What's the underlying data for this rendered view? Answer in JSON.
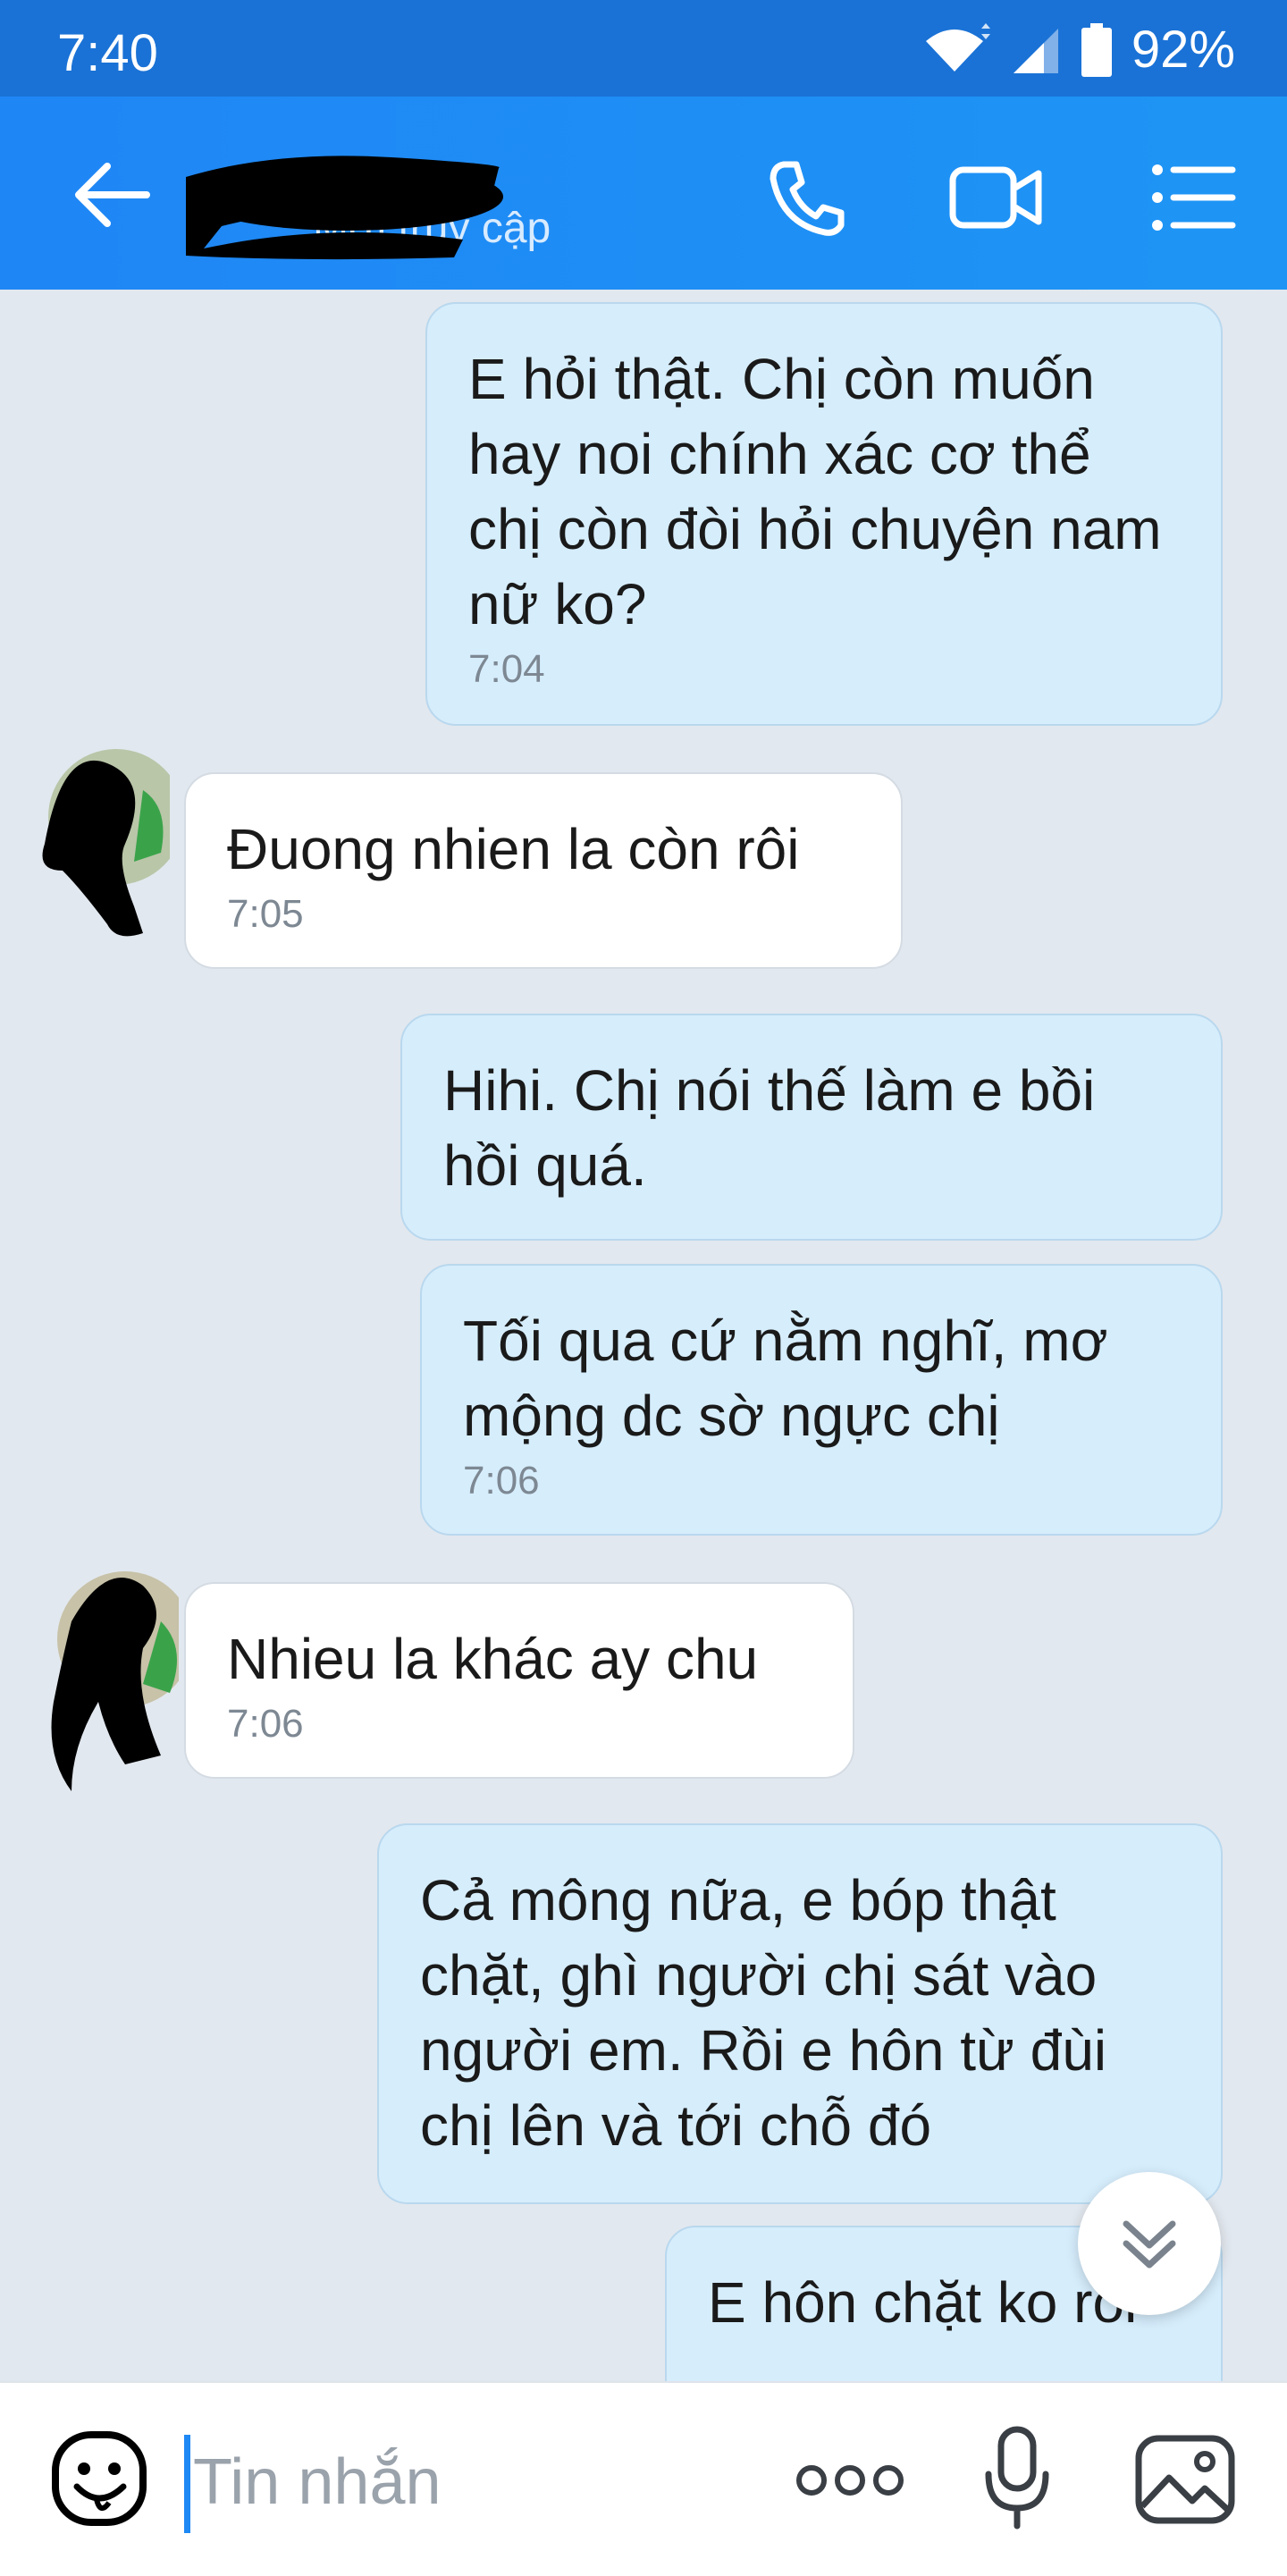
{
  "status_bar": {
    "time": "7:40",
    "battery": "92%"
  },
  "header": {
    "contact_name": "",
    "status": "Mới truy cập"
  },
  "messages": [
    {
      "direction": "out",
      "text": "E hỏi thật. Chị còn muốn hay noi chính xác cơ thể chị còn đòi hỏi chuyện nam nữ ko?",
      "time": "7:04"
    },
    {
      "direction": "in",
      "text": "Đuong nhien la còn rôi",
      "time": "7:05"
    },
    {
      "direction": "out",
      "text": "Hihi. Chị nói thế làm e bồi hồi quá.",
      "time": ""
    },
    {
      "direction": "out",
      "text": "Tối qua cứ nằm nghĩ, mơ mộng dc sờ ngực chị",
      "time": "7:06"
    },
    {
      "direction": "in",
      "text": "Nhieu la khác ay chu",
      "time": "7:06"
    },
    {
      "direction": "out",
      "text": "Cả mông nữa, e bóp thật chặt, ghì người chị sát vào người em. Rồi e hôn từ đùi chị lên và tới chỗ đó",
      "time": ""
    },
    {
      "direction": "out",
      "text": "E hôn chặt ko rồi",
      "time": ""
    }
  ],
  "composer": {
    "placeholder": "Tin nhắn"
  },
  "colors": {
    "header": "#1f8ef5",
    "outgoing_bubble": "#d6edfc",
    "incoming_bubble": "#ffffff",
    "background": "#e2e8ef"
  },
  "icons": [
    "back-arrow-icon",
    "phone-icon",
    "video-call-icon",
    "menu-list-icon",
    "scroll-down-icon",
    "sticker-icon",
    "more-options-icon",
    "microphone-icon",
    "image-icon"
  ]
}
